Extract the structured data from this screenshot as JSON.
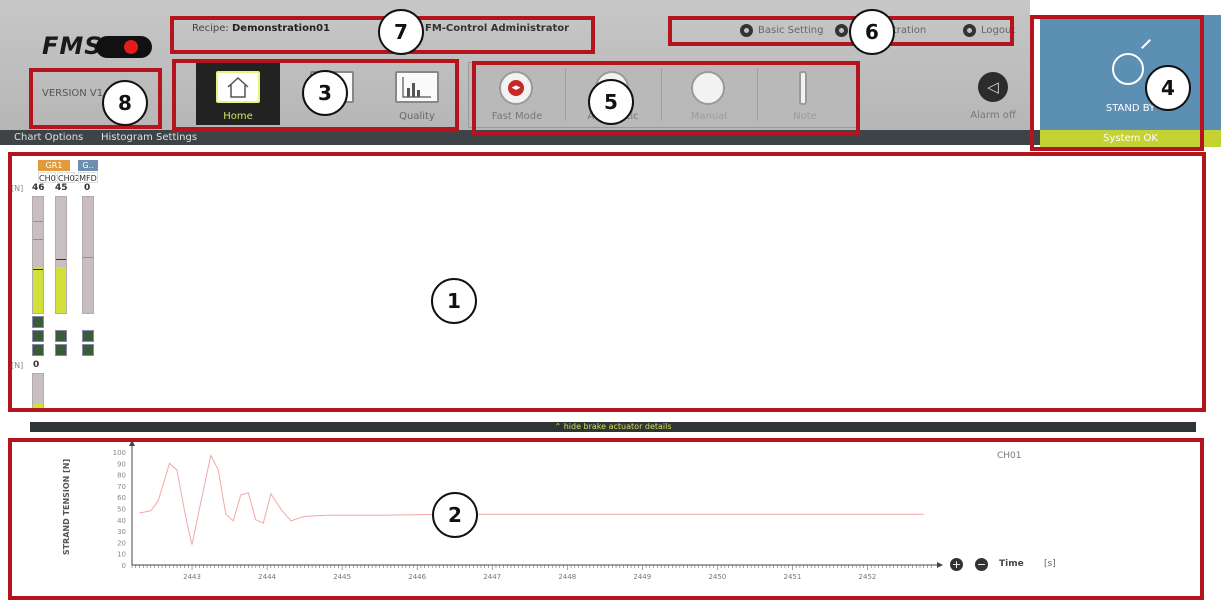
{
  "header": {
    "logo_text": "FMS",
    "version": "VERSION V1",
    "recipe_label": "Recipe: ",
    "recipe_name": "Demonstration01",
    "user": "FM-Control Administrator",
    "links": [
      {
        "label": "Basic Setting",
        "icon": "gear-icon"
      },
      {
        "label": "Administration",
        "icon": "user-icon"
      },
      {
        "label": "Logout",
        "icon": "lock-icon"
      }
    ]
  },
  "nav": {
    "tiles": [
      {
        "label": "Home",
        "icon": "home-icon",
        "active": true
      },
      {
        "label": "",
        "icon": "monitor-icon",
        "active": false
      },
      {
        "label": "Quality",
        "icon": "quality-chart-icon",
        "active": false
      }
    ]
  },
  "modes": [
    {
      "label": "Fast Mode",
      "icon": "fast-mode-icon"
    },
    {
      "label": "Automatic",
      "icon": "automatic-icon"
    },
    {
      "label": "Manual",
      "icon": "manual-icon"
    },
    {
      "label": "Note",
      "icon": "note-icon"
    }
  ],
  "alarm": {
    "label": "Alarm off",
    "icon": "speaker-icon"
  },
  "status": {
    "state": "STAND BY",
    "system": "System OK",
    "icon": "standby-icon"
  },
  "menubar": {
    "chart_options": "Chart Options",
    "histogram_settings": "Histogram Settings"
  },
  "channels": {
    "groups": [
      {
        "label": "GR1",
        "color": "#e39a3a"
      },
      {
        "label": "G..",
        "color": "#6f8fb0"
      }
    ],
    "unit": "[N]",
    "items": [
      {
        "name": "CH01",
        "value": "46",
        "fill": 0.4
      },
      {
        "name": "CH02",
        "value": "45",
        "fill": 0.4
      },
      {
        "name": "MFD",
        "value": "0",
        "fill": 0
      }
    ],
    "second_unit": "[N]",
    "second_value": "0"
  },
  "brake_toggle": "hide brake actuator details",
  "chart_data": {
    "type": "line",
    "ylabel": "STRAND TENSION  [N]",
    "xlabel": "Time",
    "xunit": "[s]",
    "series": [
      {
        "name": "CH01",
        "color": "#f2a7a7",
        "points": [
          [
            2442.3,
            46
          ],
          [
            2442.45,
            48
          ],
          [
            2442.55,
            57
          ],
          [
            2442.7,
            90
          ],
          [
            2442.8,
            84
          ],
          [
            2442.9,
            48
          ],
          [
            2442.95,
            32
          ],
          [
            2443.0,
            18
          ],
          [
            2443.1,
            50
          ],
          [
            2443.25,
            97
          ],
          [
            2443.35,
            84
          ],
          [
            2443.45,
            45
          ],
          [
            2443.55,
            39
          ],
          [
            2443.65,
            62
          ],
          [
            2443.75,
            64
          ],
          [
            2443.85,
            40
          ],
          [
            2443.95,
            37
          ],
          [
            2444.05,
            63
          ],
          [
            2444.2,
            48
          ],
          [
            2444.32,
            39
          ],
          [
            2444.4,
            41
          ],
          [
            2444.5,
            43
          ],
          [
            2444.8,
            44
          ],
          [
            2445.5,
            44
          ],
          [
            2446.5,
            45
          ],
          [
            2447.5,
            45
          ],
          [
            2448.5,
            45
          ],
          [
            2449.5,
            45
          ],
          [
            2450.5,
            45
          ],
          [
            2451.5,
            45
          ],
          [
            2452.75,
            45
          ]
        ]
      }
    ],
    "ylim": [
      0,
      100
    ],
    "yticks": [
      "0",
      "10",
      "20",
      "30",
      "40",
      "50",
      "60",
      "70",
      "80",
      "90",
      "100"
    ],
    "xticks": [
      "2443",
      "2444",
      "2445",
      "2446",
      "2447",
      "2448",
      "2449",
      "2450",
      "2451",
      "2452"
    ],
    "xlim": [
      2442.2,
      2452.9
    ]
  },
  "callouts": [
    "1",
    "2",
    "3",
    "4",
    "5",
    "6",
    "7",
    "8"
  ]
}
